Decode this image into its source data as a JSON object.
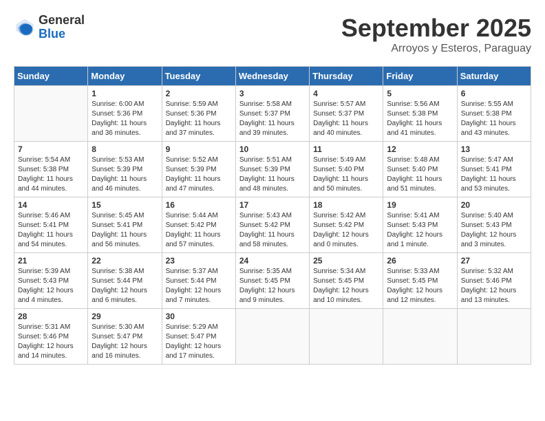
{
  "header": {
    "logo_general": "General",
    "logo_blue": "Blue",
    "month_title": "September 2025",
    "subtitle": "Arroyos y Esteros, Paraguay"
  },
  "days_of_week": [
    "Sunday",
    "Monday",
    "Tuesday",
    "Wednesday",
    "Thursday",
    "Friday",
    "Saturday"
  ],
  "weeks": [
    [
      {
        "day": "",
        "sunrise": "",
        "sunset": "",
        "daylight": ""
      },
      {
        "day": "1",
        "sunrise": "Sunrise: 6:00 AM",
        "sunset": "Sunset: 5:36 PM",
        "daylight": "Daylight: 11 hours and 36 minutes."
      },
      {
        "day": "2",
        "sunrise": "Sunrise: 5:59 AM",
        "sunset": "Sunset: 5:36 PM",
        "daylight": "Daylight: 11 hours and 37 minutes."
      },
      {
        "day": "3",
        "sunrise": "Sunrise: 5:58 AM",
        "sunset": "Sunset: 5:37 PM",
        "daylight": "Daylight: 11 hours and 39 minutes."
      },
      {
        "day": "4",
        "sunrise": "Sunrise: 5:57 AM",
        "sunset": "Sunset: 5:37 PM",
        "daylight": "Daylight: 11 hours and 40 minutes."
      },
      {
        "day": "5",
        "sunrise": "Sunrise: 5:56 AM",
        "sunset": "Sunset: 5:38 PM",
        "daylight": "Daylight: 11 hours and 41 minutes."
      },
      {
        "day": "6",
        "sunrise": "Sunrise: 5:55 AM",
        "sunset": "Sunset: 5:38 PM",
        "daylight": "Daylight: 11 hours and 43 minutes."
      }
    ],
    [
      {
        "day": "7",
        "sunrise": "Sunrise: 5:54 AM",
        "sunset": "Sunset: 5:38 PM",
        "daylight": "Daylight: 11 hours and 44 minutes."
      },
      {
        "day": "8",
        "sunrise": "Sunrise: 5:53 AM",
        "sunset": "Sunset: 5:39 PM",
        "daylight": "Daylight: 11 hours and 46 minutes."
      },
      {
        "day": "9",
        "sunrise": "Sunrise: 5:52 AM",
        "sunset": "Sunset: 5:39 PM",
        "daylight": "Daylight: 11 hours and 47 minutes."
      },
      {
        "day": "10",
        "sunrise": "Sunrise: 5:51 AM",
        "sunset": "Sunset: 5:39 PM",
        "daylight": "Daylight: 11 hours and 48 minutes."
      },
      {
        "day": "11",
        "sunrise": "Sunrise: 5:49 AM",
        "sunset": "Sunset: 5:40 PM",
        "daylight": "Daylight: 11 hours and 50 minutes."
      },
      {
        "day": "12",
        "sunrise": "Sunrise: 5:48 AM",
        "sunset": "Sunset: 5:40 PM",
        "daylight": "Daylight: 11 hours and 51 minutes."
      },
      {
        "day": "13",
        "sunrise": "Sunrise: 5:47 AM",
        "sunset": "Sunset: 5:41 PM",
        "daylight": "Daylight: 11 hours and 53 minutes."
      }
    ],
    [
      {
        "day": "14",
        "sunrise": "Sunrise: 5:46 AM",
        "sunset": "Sunset: 5:41 PM",
        "daylight": "Daylight: 11 hours and 54 minutes."
      },
      {
        "day": "15",
        "sunrise": "Sunrise: 5:45 AM",
        "sunset": "Sunset: 5:41 PM",
        "daylight": "Daylight: 11 hours and 56 minutes."
      },
      {
        "day": "16",
        "sunrise": "Sunrise: 5:44 AM",
        "sunset": "Sunset: 5:42 PM",
        "daylight": "Daylight: 11 hours and 57 minutes."
      },
      {
        "day": "17",
        "sunrise": "Sunrise: 5:43 AM",
        "sunset": "Sunset: 5:42 PM",
        "daylight": "Daylight: 11 hours and 58 minutes."
      },
      {
        "day": "18",
        "sunrise": "Sunrise: 5:42 AM",
        "sunset": "Sunset: 5:42 PM",
        "daylight": "Daylight: 12 hours and 0 minutes."
      },
      {
        "day": "19",
        "sunrise": "Sunrise: 5:41 AM",
        "sunset": "Sunset: 5:43 PM",
        "daylight": "Daylight: 12 hours and 1 minute."
      },
      {
        "day": "20",
        "sunrise": "Sunrise: 5:40 AM",
        "sunset": "Sunset: 5:43 PM",
        "daylight": "Daylight: 12 hours and 3 minutes."
      }
    ],
    [
      {
        "day": "21",
        "sunrise": "Sunrise: 5:39 AM",
        "sunset": "Sunset: 5:43 PM",
        "daylight": "Daylight: 12 hours and 4 minutes."
      },
      {
        "day": "22",
        "sunrise": "Sunrise: 5:38 AM",
        "sunset": "Sunset: 5:44 PM",
        "daylight": "Daylight: 12 hours and 6 minutes."
      },
      {
        "day": "23",
        "sunrise": "Sunrise: 5:37 AM",
        "sunset": "Sunset: 5:44 PM",
        "daylight": "Daylight: 12 hours and 7 minutes."
      },
      {
        "day": "24",
        "sunrise": "Sunrise: 5:35 AM",
        "sunset": "Sunset: 5:45 PM",
        "daylight": "Daylight: 12 hours and 9 minutes."
      },
      {
        "day": "25",
        "sunrise": "Sunrise: 5:34 AM",
        "sunset": "Sunset: 5:45 PM",
        "daylight": "Daylight: 12 hours and 10 minutes."
      },
      {
        "day": "26",
        "sunrise": "Sunrise: 5:33 AM",
        "sunset": "Sunset: 5:45 PM",
        "daylight": "Daylight: 12 hours and 12 minutes."
      },
      {
        "day": "27",
        "sunrise": "Sunrise: 5:32 AM",
        "sunset": "Sunset: 5:46 PM",
        "daylight": "Daylight: 12 hours and 13 minutes."
      }
    ],
    [
      {
        "day": "28",
        "sunrise": "Sunrise: 5:31 AM",
        "sunset": "Sunset: 5:46 PM",
        "daylight": "Daylight: 12 hours and 14 minutes."
      },
      {
        "day": "29",
        "sunrise": "Sunrise: 5:30 AM",
        "sunset": "Sunset: 5:47 PM",
        "daylight": "Daylight: 12 hours and 16 minutes."
      },
      {
        "day": "30",
        "sunrise": "Sunrise: 5:29 AM",
        "sunset": "Sunset: 5:47 PM",
        "daylight": "Daylight: 12 hours and 17 minutes."
      },
      {
        "day": "",
        "sunrise": "",
        "sunset": "",
        "daylight": ""
      },
      {
        "day": "",
        "sunrise": "",
        "sunset": "",
        "daylight": ""
      },
      {
        "day": "",
        "sunrise": "",
        "sunset": "",
        "daylight": ""
      },
      {
        "day": "",
        "sunrise": "",
        "sunset": "",
        "daylight": ""
      }
    ]
  ]
}
